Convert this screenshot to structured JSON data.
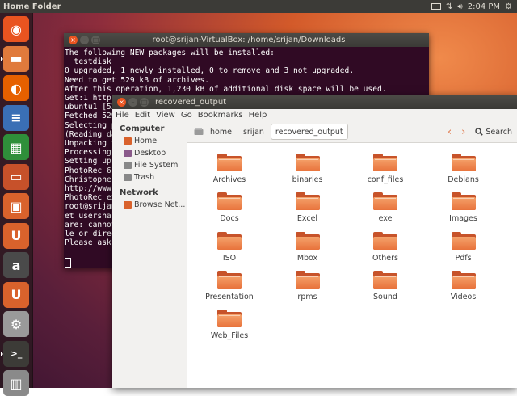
{
  "panel": {
    "title": "Home Folder",
    "time": "2:04 PM"
  },
  "launcher": [
    {
      "name": "dash-icon",
      "color": "#e95420",
      "glyph": "◉"
    },
    {
      "name": "files-icon",
      "color": "#e07a3c",
      "glyph": "▬"
    },
    {
      "name": "firefox-icon",
      "color": "#e66000",
      "glyph": "◐"
    },
    {
      "name": "writer-icon",
      "color": "#3a6fb5",
      "glyph": "≡"
    },
    {
      "name": "calc-icon",
      "color": "#2f8f3a",
      "glyph": "▦"
    },
    {
      "name": "impress-icon",
      "color": "#c7512a",
      "glyph": "▭"
    },
    {
      "name": "software-center-icon",
      "color": "#d9622c",
      "glyph": "▣"
    },
    {
      "name": "ubuntu-one-icon",
      "color": "#d9622c",
      "glyph": "U"
    },
    {
      "name": "amazon-icon",
      "color": "#4a4a4a",
      "glyph": "a"
    },
    {
      "name": "ubuntu-one-music-icon",
      "color": "#d9622c",
      "glyph": "U"
    },
    {
      "name": "settings-icon",
      "color": "#9a9a9a",
      "glyph": "⚙"
    },
    {
      "name": "terminal-icon",
      "color": "#3c3b37",
      "glyph": ">_"
    },
    {
      "name": "trash-icon",
      "color": "#8a8a8a",
      "glyph": "▥"
    }
  ],
  "terminal": {
    "title": "root@srijan-VirtualBox: /home/srijan/Downloads",
    "lines": [
      "The following NEW packages will be installed:",
      "  testdisk",
      "0 upgraded, 1 newly installed, 0 to remove and 3 not upgraded.",
      "Need to get 529 kB of archives.",
      "After this operation, 1,230 kB of additional disk space will be used.",
      "Get:1 http:",
      "ubuntu1 [52",
      "Fetched 529",
      "Selecting p",
      "(Reading da",
      "Unpacking t",
      "Processing",
      "Setting up",
      "PhotoRec 6.",
      "Christophe",
      "http://www.",
      "PhotoRec ex",
      "root@srijan",
      "et usershar",
      "are: cannot",
      "le or direc",
      "Please ask"
    ]
  },
  "files": {
    "title": "recovered_output",
    "menu": [
      "File",
      "Edit",
      "View",
      "Go",
      "Bookmarks",
      "Help"
    ],
    "sidebar": {
      "computer_header": "Computer",
      "computer_items": [
        {
          "label": "Home",
          "icon": "home-icon",
          "color": "#d9622c"
        },
        {
          "label": "Desktop",
          "icon": "desktop-icon",
          "color": "#8a5a8a"
        },
        {
          "label": "File System",
          "icon": "filesystem-icon",
          "color": "#888888"
        },
        {
          "label": "Trash",
          "icon": "trash-icon",
          "color": "#888888"
        }
      ],
      "network_header": "Network",
      "network_items": [
        {
          "label": "Browse Net...",
          "icon": "network-icon",
          "color": "#d9622c"
        }
      ]
    },
    "breadcrumbs": [
      "home",
      "srijan",
      "recovered_output"
    ],
    "search_label": "Search",
    "folders": [
      "Archives",
      "binaries",
      "conf_files",
      "Debians",
      "Docs",
      "Excel",
      "exe",
      "Images",
      "ISO",
      "Mbox",
      "Others",
      "Pdfs",
      "Presentation",
      "rpms",
      "Sound",
      "Videos",
      "Web_Files"
    ]
  }
}
